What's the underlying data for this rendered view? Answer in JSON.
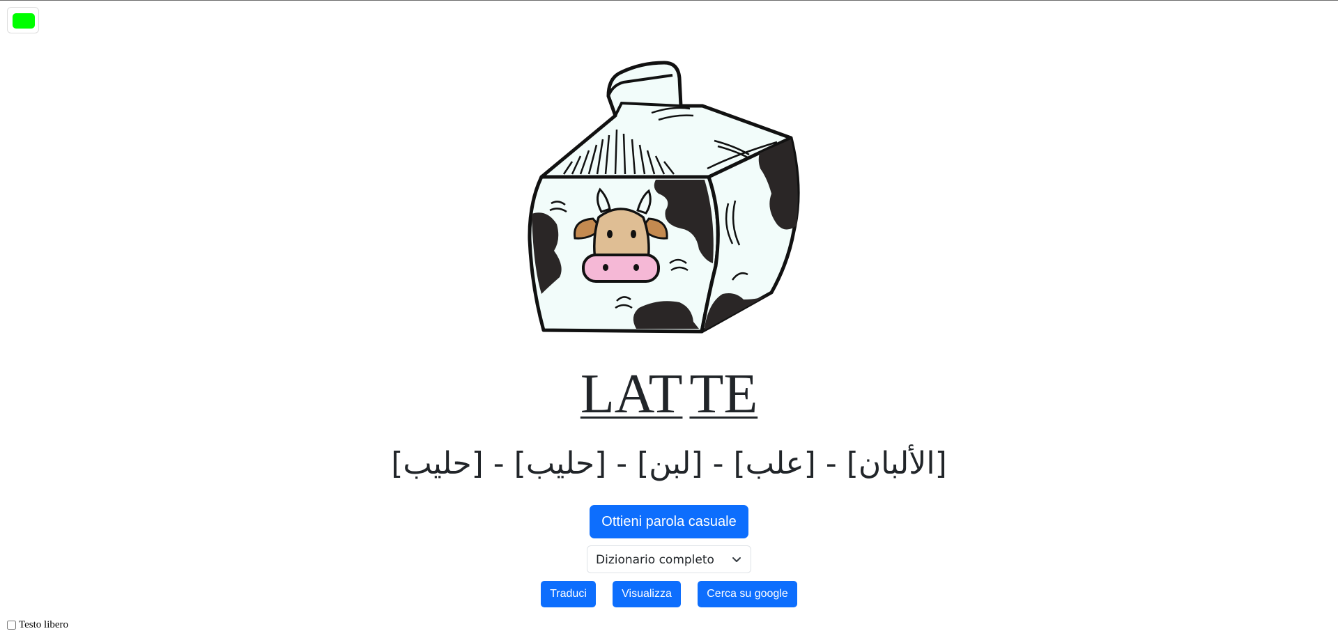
{
  "status": {
    "indicator_color": "#00ff00"
  },
  "word": {
    "syllables": [
      "LAT",
      "TE"
    ]
  },
  "translations": "[حليب] - [حليب] - [لبن] - [علب] - [الألبان]",
  "buttons": {
    "random_word": "Ottieni parola casuale",
    "translate": "Traduci",
    "visualize": "Visualizza",
    "google": "Cerca su google"
  },
  "dictionary": {
    "selected": "Dizionario completo"
  },
  "free_text": {
    "label": "Testo libero",
    "checked": false
  },
  "colors": {
    "primary": "#0d6efd",
    "carton_light": "#f2fcfa",
    "cow_face": "#dfbe94",
    "cow_snout": "#f5b8d6",
    "spots": "#2a2626"
  },
  "icons": {
    "illustration": "milk-carton-cow",
    "dropdown": "chevron-down-icon"
  }
}
